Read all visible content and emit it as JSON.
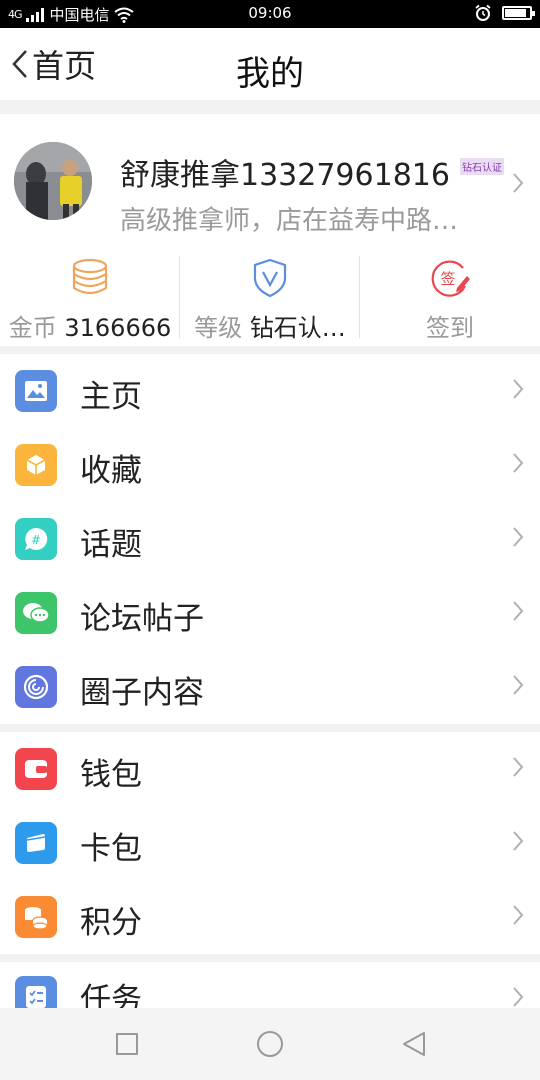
{
  "status_bar": {
    "signal_text": "4G",
    "carrier": "中国电信",
    "time": "09:06",
    "battery_level": 0.9
  },
  "header": {
    "back_label": "首页",
    "title": "我的"
  },
  "profile": {
    "name": "舒康推拿13327961816",
    "badge": "钻石认证",
    "description": "高级推拿师，店在益寿中路…"
  },
  "stats": {
    "coins_label": "金币",
    "coins_value": "3166666",
    "level_label": "等级",
    "level_value": "钻石认…",
    "checkin_label": "签到",
    "checkin_icon_text": "签"
  },
  "menu": {
    "items": [
      {
        "label": "主页",
        "icon": "image-icon",
        "color": "#5b8de0"
      },
      {
        "label": "收藏",
        "icon": "cube-icon",
        "color": "#fbb53c"
      },
      {
        "label": "话题",
        "icon": "hashtag-bubble-icon",
        "color": "#33cfc2"
      },
      {
        "label": "论坛帖子",
        "icon": "chat-bubbles-icon",
        "color": "#3ec56b"
      },
      {
        "label": "圈子内容",
        "icon": "swirl-icon",
        "color": "#6276e0"
      },
      {
        "label": "钱包",
        "icon": "wallet-icon",
        "color": "#f2454d"
      },
      {
        "label": "卡包",
        "icon": "cards-icon",
        "color": "#2e9aec"
      },
      {
        "label": "积分",
        "icon": "coins-stack-icon",
        "color": "#fb8a35"
      },
      {
        "label": "任务",
        "icon": "checklist-icon",
        "color": "#5b8de0"
      }
    ]
  },
  "colors": {
    "coin": "#f0a55a",
    "level": "#5b8de0",
    "checkin": "#e8474c",
    "chevron": "#b0b0b0"
  }
}
